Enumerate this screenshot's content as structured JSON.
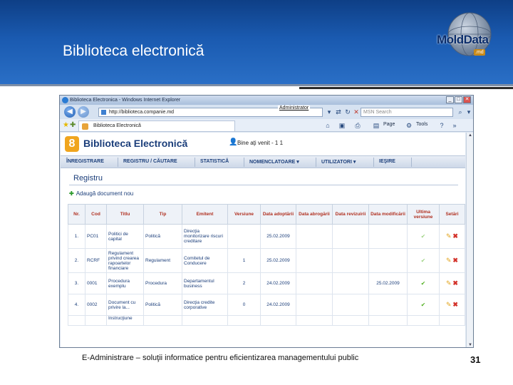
{
  "slide": {
    "title": "Biblioteca electronică",
    "footer": "E-Administrare – soluţii informatice pentru eficientizarea managementului public",
    "page_number": "31",
    "logo_text": "MoldData",
    "logo_sub": ".md"
  },
  "browser": {
    "window_title": "Biblioteca Electronica - Windows Internet Explorer",
    "url": "http://biblioteca.companie.md",
    "admin_label": "Administrator",
    "search_placeholder": "MSN Search",
    "tab_label": "Biblioteca Electronică",
    "commands": {
      "page": "Page",
      "tools": "Tools"
    }
  },
  "app": {
    "title": "Biblioteca Electronică",
    "welcome": "Bine aţi venit - 1 1",
    "menu": [
      {
        "label": "ÎNREGISTRARE"
      },
      {
        "label": "REGISTRU / CĂUTARE"
      },
      {
        "label": "STATISTICĂ"
      },
      {
        "label": "NOMENCLATOARE ▾"
      },
      {
        "label": "UTILIZATORI ▾"
      },
      {
        "label": "IEŞIRE"
      }
    ],
    "section_title": "Registru",
    "add_document": "Adaugă document nou"
  },
  "table": {
    "headers": [
      "Nr.",
      "Cod",
      "Titlu",
      "Tip",
      "Emitent",
      "Versiune",
      "Data adoptării",
      "Data abrogării",
      "Data revizuirii",
      "Data modificării",
      "Ultima versiune",
      "Setări"
    ],
    "rows": [
      {
        "nr": "1.",
        "cod": "PC01",
        "titlu": "Politici de capital",
        "tip": "Politică",
        "emitent": "Direcţia monitorizare riscuri creditare",
        "versiune": "",
        "adoptare": "25.02.2009",
        "abrogare": "",
        "revizuire": "",
        "modificare": "",
        "ultima": true
      },
      {
        "nr": "2.",
        "cod": "RCRF",
        "titlu": "Regulament privind crearea rapoartelor financiare",
        "tip": "Regulament",
        "emitent": "Comitetul de Conducere",
        "versiune": "1",
        "adoptare": "25.02.2009",
        "abrogare": "",
        "revizuire": "",
        "modificare": "",
        "ultima": true
      },
      {
        "nr": "3.",
        "cod": "0001",
        "titlu": "Procedura exemplu",
        "tip": "Procedura",
        "emitent": "Departamentul business",
        "versiune": "2",
        "adoptare": "24.02.2009",
        "abrogare": "",
        "revizuire": "",
        "modificare": "25.02.2009",
        "ultima": true
      },
      {
        "nr": "4.",
        "cod": "0002",
        "titlu": "Document cu privire la...",
        "tip": "Politică",
        "emitent": "Direcţia credite corporative",
        "versiune": "0",
        "adoptare": "24.02.2009",
        "abrogare": "",
        "revizuire": "",
        "modificare": "",
        "ultima": true
      },
      {
        "nr": "",
        "cod": "",
        "titlu": "Instrucţiune",
        "tip": "",
        "emitent": "",
        "versiune": "",
        "adoptare": "",
        "abrogare": "",
        "revizuire": "",
        "modificare": "",
        "ultima": false
      }
    ]
  },
  "icons": {
    "check": "check-icon",
    "edit": "pencil-icon",
    "delete": "delete-x-icon"
  },
  "colors": {
    "header_blue": "#1a5ab0",
    "app_title": "#1b3e7a",
    "table_header_text": "#b03020",
    "logo_orange": "#f0a51e"
  }
}
